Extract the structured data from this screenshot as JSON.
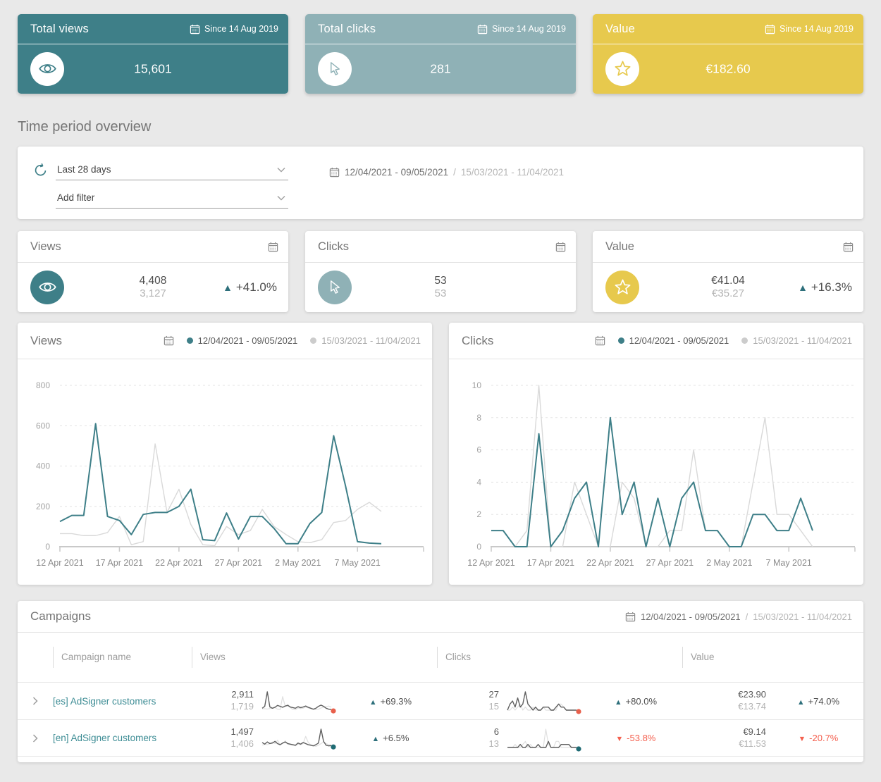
{
  "summary_cards": [
    {
      "title": "Total views",
      "badge": "Since 14 Aug 2019",
      "value": "15,601",
      "icon": "eye-icon",
      "bg": "#3E7F88"
    },
    {
      "title": "Total clicks",
      "badge": "Since 14 Aug 2019",
      "value": "281",
      "icon": "cursor-icon",
      "bg": "#8FB1B6"
    },
    {
      "title": "Value",
      "badge": "Since 14 Aug 2019",
      "value": "€182.60",
      "icon": "star-icon",
      "bg": "#E7C94D"
    }
  ],
  "section_title": "Time period overview",
  "filters": {
    "period_select": "Last 28 days",
    "filter_select": "Add filter",
    "date_range_current": "12/04/2021 - 09/05/2021",
    "date_range_separator": "/",
    "date_range_previous": "15/03/2021 - 11/04/2021",
    "refresh_icon": "refresh-icon",
    "calendar_icon": "calendar-icon"
  },
  "stat_cards": [
    {
      "title": "Views",
      "icon": "eye-icon",
      "color": "#3E7F88",
      "current": "4,408",
      "previous": "3,127",
      "delta": {
        "dir": "up",
        "label": "+41.0%"
      }
    },
    {
      "title": "Clicks",
      "icon": "cursor-icon",
      "color": "#8FB1B6",
      "current": "53",
      "previous": "53",
      "delta": null
    },
    {
      "title": "Value",
      "icon": "star-icon",
      "color": "#E7C94D",
      "current": "€41.04",
      "previous": "€35.27",
      "delta": {
        "dir": "up",
        "label": "+16.3%"
      }
    }
  ],
  "charts": [
    {
      "type": "line",
      "title": "Views",
      "ymax": 800,
      "y_ticks": [
        0,
        200,
        400,
        600,
        800
      ],
      "x_ticks": [
        "12 Apr 2021",
        "17 Apr 2021",
        "22 Apr 2021",
        "27 Apr 2021",
        "2 May 2021",
        "7 May 2021"
      ],
      "x_tick_days": [
        0,
        5,
        10,
        15,
        20,
        25
      ],
      "legend": [
        {
          "label": "12/04/2021 - 09/05/2021",
          "color": "#3E7F88"
        },
        {
          "label": "15/03/2021 - 11/04/2021",
          "color": "#cccccc"
        }
      ],
      "series": [
        {
          "name": "current",
          "color": "#3E7F88",
          "values": [
            125,
            155,
            155,
            610,
            150,
            130,
            60,
            160,
            170,
            170,
            200,
            285,
            35,
            30,
            167,
            38,
            150,
            150,
            90,
            15,
            15,
            115,
            170,
            550,
            300,
            25,
            18,
            15
          ]
        },
        {
          "name": "previous",
          "color": "#d9d9d9",
          "values": [
            65,
            65,
            55,
            55,
            70,
            150,
            10,
            25,
            510,
            170,
            285,
            110,
            10,
            5,
            100,
            60,
            80,
            185,
            100,
            60,
            25,
            20,
            35,
            120,
            130,
            185,
            220,
            175
          ]
        }
      ]
    },
    {
      "type": "line",
      "title": "Clicks",
      "ymax": 10,
      "y_ticks": [
        0,
        2,
        4,
        6,
        8,
        10
      ],
      "x_ticks": [
        "12 Apr 2021",
        "17 Apr 2021",
        "22 Apr 2021",
        "27 Apr 2021",
        "2 May 2021",
        "7 May 2021"
      ],
      "x_tick_days": [
        0,
        5,
        10,
        15,
        20,
        25
      ],
      "legend": [
        {
          "label": "12/04/2021 - 09/05/2021",
          "color": "#3E7F88"
        },
        {
          "label": "15/03/2021 - 11/04/2021",
          "color": "#cccccc"
        }
      ],
      "series": [
        {
          "name": "current",
          "color": "#3E7F88",
          "values": [
            1,
            1,
            0,
            0,
            7,
            0,
            1,
            3,
            4,
            0,
            8,
            2,
            4,
            0,
            3,
            0,
            3,
            4,
            1,
            1,
            0,
            0,
            2,
            2,
            1,
            1,
            3,
            1
          ]
        },
        {
          "name": "previous",
          "color": "#d9d9d9",
          "values": [
            1,
            1,
            0,
            1,
            10,
            0,
            0,
            4,
            2,
            0,
            0,
            4,
            3,
            0,
            0,
            1,
            1,
            6,
            1,
            1,
            0,
            0,
            4,
            8,
            2,
            2,
            1,
            0
          ]
        }
      ]
    }
  ],
  "campaigns": {
    "title": "Campaigns",
    "date_range_current": "12/04/2021 - 09/05/2021",
    "date_range_separator": "/",
    "date_range_previous": "15/03/2021 - 11/04/2021",
    "columns": [
      "Campaign name",
      "Views",
      "Clicks",
      "Value"
    ],
    "rows": [
      {
        "name": "[es] AdSigner customers",
        "views": {
          "current": "2,911",
          "previous": "1,719",
          "delta": {
            "dir": "up",
            "label": "+69.3%"
          },
          "spark": {
            "dot": "#E8604C",
            "current": [
              60,
              120,
              580,
              100,
              60,
              90,
              150,
              120,
              90,
              130,
              150,
              100,
              80,
              60,
              110,
              80,
              100,
              130,
              90,
              60,
              30,
              60,
              120,
              160,
              120,
              60,
              30,
              20
            ],
            "previous": [
              40,
              45,
              35,
              50,
              60,
              80,
              30,
              20,
              430,
              120,
              180,
              80,
              20,
              10,
              70,
              50,
              60,
              100,
              70,
              50,
              20,
              15,
              30,
              70,
              90,
              110,
              130,
              95
            ]
          }
        },
        "clicks": {
          "current": "27",
          "previous": "15",
          "delta": {
            "dir": "up",
            "label": "+80.0%"
          },
          "spark": {
            "dot": "#E8604C",
            "current": [
              0,
              2,
              3,
              1,
              4,
              1,
              2,
              6,
              2,
              1,
              0,
              1,
              0,
              0,
              1,
              1,
              1,
              0,
              0,
              1,
              2,
              1,
              1,
              0,
              0,
              0,
              0,
              0
            ],
            "previous": [
              0,
              0,
              1,
              0,
              1,
              2,
              0,
              1,
              0,
              0,
              1,
              0,
              0,
              0,
              1,
              0,
              0,
              0,
              0,
              0,
              2,
              2,
              1,
              0,
              0,
              0,
              0,
              0
            ]
          }
        },
        "value": {
          "current": "€23.90",
          "previous": "€13.74",
          "delta": {
            "dir": "up",
            "label": "+74.0%"
          }
        }
      },
      {
        "name": "[en] AdSigner customers",
        "views": {
          "current": "1,497",
          "previous": "1,406",
          "delta": {
            "dir": "up",
            "label": "+6.5%"
          },
          "spark": {
            "dot": "#1F6B74",
            "current": [
              90,
              60,
              100,
              70,
              80,
              110,
              70,
              50,
              80,
              100,
              70,
              60,
              50,
              40,
              80,
              60,
              90,
              70,
              50,
              40,
              30,
              50,
              80,
              330,
              110,
              40,
              30,
              35
            ],
            "previous": [
              40,
              60,
              50,
              70,
              100,
              70,
              130,
              50,
              70,
              120,
              60,
              50,
              40,
              30,
              60,
              50,
              70,
              200,
              90,
              50,
              30,
              20,
              40,
              70,
              100,
              70,
              50,
              40
            ]
          }
        },
        "clicks": {
          "current": "6",
          "previous": "13",
          "delta": {
            "dir": "down",
            "label": "-53.8%"
          },
          "spark": {
            "dot": "#1F6B74",
            "current": [
              0,
              0,
              0,
              0,
              0,
              1,
              0,
              0,
              1,
              0,
              0,
              0,
              1,
              0,
              0,
              0,
              2,
              0,
              0,
              0,
              0,
              1,
              1,
              1,
              1,
              0,
              0,
              0
            ],
            "previous": [
              0,
              0,
              0,
              1,
              0,
              0,
              1,
              2,
              0,
              1,
              0,
              0,
              0,
              0,
              0,
              6,
              1,
              0,
              0,
              2,
              2,
              0,
              0,
              0,
              0,
              0,
              0,
              0
            ]
          }
        },
        "value": {
          "current": "€9.14",
          "previous": "€11.53",
          "delta": {
            "dir": "down",
            "label": "-20.7%"
          }
        }
      }
    ]
  }
}
